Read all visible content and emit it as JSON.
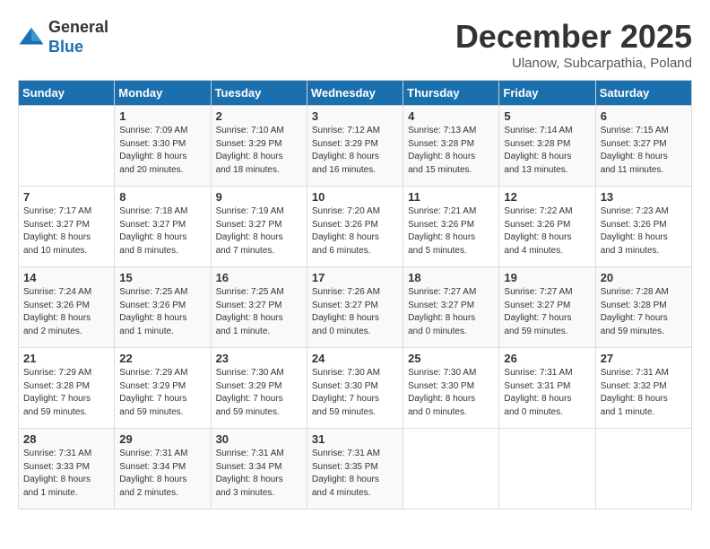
{
  "logo": {
    "general": "General",
    "blue": "Blue"
  },
  "title": "December 2025",
  "subtitle": "Ulanow, Subcarpathia, Poland",
  "days_header": [
    "Sunday",
    "Monday",
    "Tuesday",
    "Wednesday",
    "Thursday",
    "Friday",
    "Saturday"
  ],
  "weeks": [
    [
      {
        "day": "",
        "info": ""
      },
      {
        "day": "1",
        "info": "Sunrise: 7:09 AM\nSunset: 3:30 PM\nDaylight: 8 hours\nand 20 minutes."
      },
      {
        "day": "2",
        "info": "Sunrise: 7:10 AM\nSunset: 3:29 PM\nDaylight: 8 hours\nand 18 minutes."
      },
      {
        "day": "3",
        "info": "Sunrise: 7:12 AM\nSunset: 3:29 PM\nDaylight: 8 hours\nand 16 minutes."
      },
      {
        "day": "4",
        "info": "Sunrise: 7:13 AM\nSunset: 3:28 PM\nDaylight: 8 hours\nand 15 minutes."
      },
      {
        "day": "5",
        "info": "Sunrise: 7:14 AM\nSunset: 3:28 PM\nDaylight: 8 hours\nand 13 minutes."
      },
      {
        "day": "6",
        "info": "Sunrise: 7:15 AM\nSunset: 3:27 PM\nDaylight: 8 hours\nand 11 minutes."
      }
    ],
    [
      {
        "day": "7",
        "info": "Sunrise: 7:17 AM\nSunset: 3:27 PM\nDaylight: 8 hours\nand 10 minutes."
      },
      {
        "day": "8",
        "info": "Sunrise: 7:18 AM\nSunset: 3:27 PM\nDaylight: 8 hours\nand 8 minutes."
      },
      {
        "day": "9",
        "info": "Sunrise: 7:19 AM\nSunset: 3:27 PM\nDaylight: 8 hours\nand 7 minutes."
      },
      {
        "day": "10",
        "info": "Sunrise: 7:20 AM\nSunset: 3:26 PM\nDaylight: 8 hours\nand 6 minutes."
      },
      {
        "day": "11",
        "info": "Sunrise: 7:21 AM\nSunset: 3:26 PM\nDaylight: 8 hours\nand 5 minutes."
      },
      {
        "day": "12",
        "info": "Sunrise: 7:22 AM\nSunset: 3:26 PM\nDaylight: 8 hours\nand 4 minutes."
      },
      {
        "day": "13",
        "info": "Sunrise: 7:23 AM\nSunset: 3:26 PM\nDaylight: 8 hours\nand 3 minutes."
      }
    ],
    [
      {
        "day": "14",
        "info": "Sunrise: 7:24 AM\nSunset: 3:26 PM\nDaylight: 8 hours\nand 2 minutes."
      },
      {
        "day": "15",
        "info": "Sunrise: 7:25 AM\nSunset: 3:26 PM\nDaylight: 8 hours\nand 1 minute."
      },
      {
        "day": "16",
        "info": "Sunrise: 7:25 AM\nSunset: 3:27 PM\nDaylight: 8 hours\nand 1 minute."
      },
      {
        "day": "17",
        "info": "Sunrise: 7:26 AM\nSunset: 3:27 PM\nDaylight: 8 hours\nand 0 minutes."
      },
      {
        "day": "18",
        "info": "Sunrise: 7:27 AM\nSunset: 3:27 PM\nDaylight: 8 hours\nand 0 minutes."
      },
      {
        "day": "19",
        "info": "Sunrise: 7:27 AM\nSunset: 3:27 PM\nDaylight: 7 hours\nand 59 minutes."
      },
      {
        "day": "20",
        "info": "Sunrise: 7:28 AM\nSunset: 3:28 PM\nDaylight: 7 hours\nand 59 minutes."
      }
    ],
    [
      {
        "day": "21",
        "info": "Sunrise: 7:29 AM\nSunset: 3:28 PM\nDaylight: 7 hours\nand 59 minutes."
      },
      {
        "day": "22",
        "info": "Sunrise: 7:29 AM\nSunset: 3:29 PM\nDaylight: 7 hours\nand 59 minutes."
      },
      {
        "day": "23",
        "info": "Sunrise: 7:30 AM\nSunset: 3:29 PM\nDaylight: 7 hours\nand 59 minutes."
      },
      {
        "day": "24",
        "info": "Sunrise: 7:30 AM\nSunset: 3:30 PM\nDaylight: 7 hours\nand 59 minutes."
      },
      {
        "day": "25",
        "info": "Sunrise: 7:30 AM\nSunset: 3:30 PM\nDaylight: 8 hours\nand 0 minutes."
      },
      {
        "day": "26",
        "info": "Sunrise: 7:31 AM\nSunset: 3:31 PM\nDaylight: 8 hours\nand 0 minutes."
      },
      {
        "day": "27",
        "info": "Sunrise: 7:31 AM\nSunset: 3:32 PM\nDaylight: 8 hours\nand 1 minute."
      }
    ],
    [
      {
        "day": "28",
        "info": "Sunrise: 7:31 AM\nSunset: 3:33 PM\nDaylight: 8 hours\nand 1 minute."
      },
      {
        "day": "29",
        "info": "Sunrise: 7:31 AM\nSunset: 3:34 PM\nDaylight: 8 hours\nand 2 minutes."
      },
      {
        "day": "30",
        "info": "Sunrise: 7:31 AM\nSunset: 3:34 PM\nDaylight: 8 hours\nand 3 minutes."
      },
      {
        "day": "31",
        "info": "Sunrise: 7:31 AM\nSunset: 3:35 PM\nDaylight: 8 hours\nand 4 minutes."
      },
      {
        "day": "",
        "info": ""
      },
      {
        "day": "",
        "info": ""
      },
      {
        "day": "",
        "info": ""
      }
    ]
  ]
}
